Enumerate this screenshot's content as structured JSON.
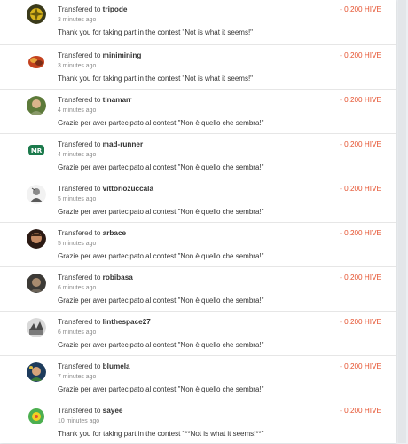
{
  "transfers": [
    {
      "prefix": "Transfered to",
      "user": "tripode",
      "time": "3 minutes ago",
      "memo": "Thank you for taking part in the contest \"Not is what it seems!\"",
      "amount": "- 0.200 HIVE",
      "avatar_icon": "tripode-avatar-icon"
    },
    {
      "prefix": "Transfered to",
      "user": "minimining",
      "time": "3 minutes ago",
      "memo": "Thank you for taking part in the contest \"Not is what it seems!\"",
      "amount": "- 0.200 HIVE",
      "avatar_icon": "minimining-avatar-icon"
    },
    {
      "prefix": "Transfered to",
      "user": "tinamarr",
      "time": "4 minutes ago",
      "memo": "Grazie per aver partecipato al contest \"Non è quello che sembra!\"",
      "amount": "- 0.200 HIVE",
      "avatar_icon": "tinamarr-avatar-icon"
    },
    {
      "prefix": "Transfered to",
      "user": "mad-runner",
      "time": "4 minutes ago",
      "memo": "Grazie per aver partecipato al contest \"Non è quello che sembra!\"",
      "amount": "- 0.200 HIVE",
      "avatar_icon": "mad-runner-avatar-icon"
    },
    {
      "prefix": "Transfered to",
      "user": "vittoriozuccala",
      "time": "5 minutes ago",
      "memo": "Grazie per aver partecipato al contest \"Non è quello che sembra!\"",
      "amount": "- 0.200 HIVE",
      "avatar_icon": "vittoriozuccala-avatar-icon"
    },
    {
      "prefix": "Transfered to",
      "user": "arbace",
      "time": "5 minutes ago",
      "memo": "Grazie per aver partecipato al contest \"Non è quello che sembra!\"",
      "amount": "- 0.200 HIVE",
      "avatar_icon": "arbace-avatar-icon"
    },
    {
      "prefix": "Transfered to",
      "user": "robibasa",
      "time": "6 minutes ago",
      "memo": "Grazie per aver partecipato al contest \"Non è quello che sembra!\"",
      "amount": "- 0.200 HIVE",
      "avatar_icon": "robibasa-avatar-icon"
    },
    {
      "prefix": "Transfered to",
      "user": "linthespace27",
      "time": "6 minutes ago",
      "memo": "Grazie per aver partecipato al contest \"Non è quello che sembra!\"",
      "amount": "- 0.200 HIVE",
      "avatar_icon": "linthespace27-avatar-icon"
    },
    {
      "prefix": "Transfered to",
      "user": "blumela",
      "time": "7 minutes ago",
      "memo": "Grazie per aver partecipato al contest \"Non è quello che sembra!\"",
      "amount": "- 0.200 HIVE",
      "avatar_icon": "blumela-avatar-icon"
    },
    {
      "prefix": "Transfered to",
      "user": "sayee",
      "time": "10 minutes ago",
      "memo": "Thank you for taking part in the contest \"**Not is what it seems!**\"",
      "amount": "- 0.200 HIVE",
      "avatar_icon": "sayee-avatar-icon"
    }
  ],
  "colors": {
    "amount": "#e5512e",
    "background": "#ffffff",
    "divider": "#e6e6e6"
  }
}
